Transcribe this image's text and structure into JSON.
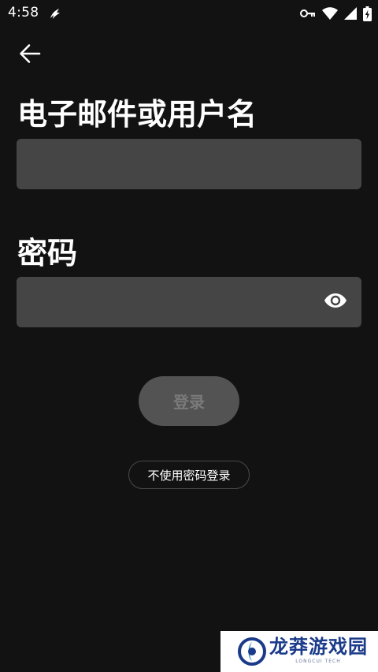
{
  "status_bar": {
    "time": "4:58",
    "icons": [
      "app-notification-icon",
      "vpn-key-icon",
      "wifi-icon",
      "signal-icon",
      "battery-charging-icon"
    ]
  },
  "navigation": {
    "back_icon": "arrow-left-icon"
  },
  "form": {
    "email_label": "电子邮件或用户名",
    "email_value": "",
    "password_label": "密码",
    "password_value": "",
    "password_toggle_icon": "eye-icon",
    "login_label": "登录",
    "passwordless_label": "不使用密码登录"
  },
  "watermark": {
    "text": "龙莽游戏园",
    "subtext": "LONGCUI TECH"
  },
  "colors": {
    "background": "#121212",
    "field_background": "#454545",
    "button_disabled_background": "#535353",
    "button_disabled_text": "#7a7a7a",
    "text_primary": "#ffffff"
  }
}
